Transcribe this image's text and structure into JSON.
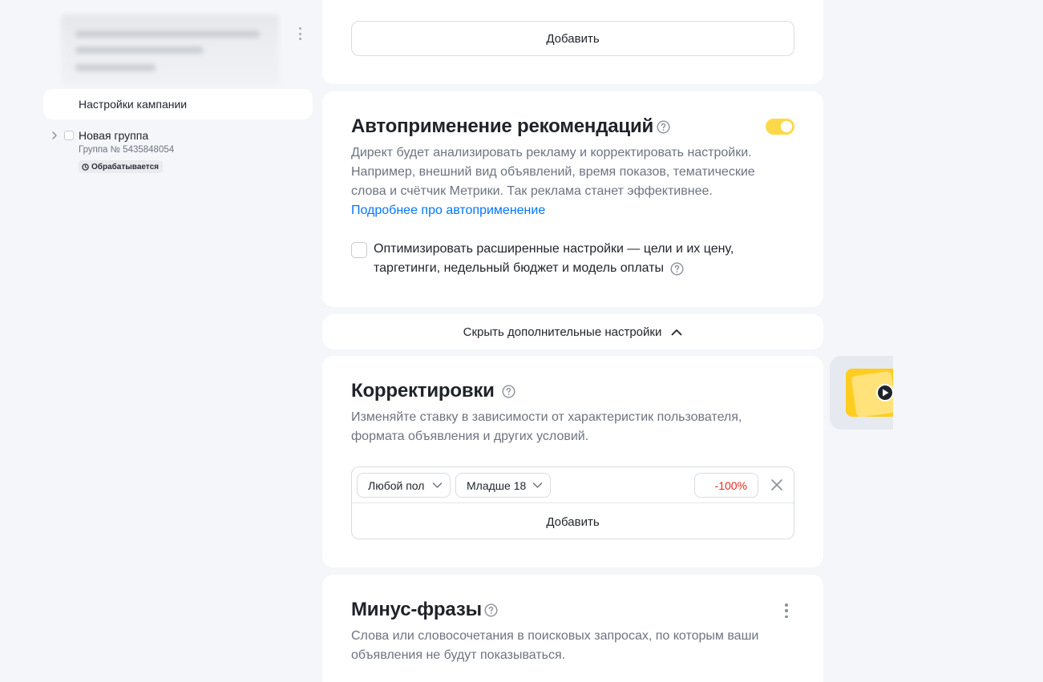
{
  "sidebar": {
    "nav_active": "Настройки кампании",
    "group": {
      "name": "Новая группа",
      "number": "Группа № 5435848054",
      "status": "Обрабатывается"
    }
  },
  "top_card": {
    "add_button": "Добавить"
  },
  "autoapply": {
    "title": "Автоприменение рекомендаций",
    "enabled": true,
    "description_lines": [
      "Директ будет анализировать рекламу и корректировать настройки.",
      "Например, внешний вид объявлений, время показов, тематические",
      "слова и счётчик Метрики. Так реклама станет эффективнее."
    ],
    "link": "Подробнее про автоприменение",
    "checkbox_checked": false,
    "checkbox_label_lines": [
      "Оптимизировать расширенные настройки — цели и их цену,",
      "таргетинги, недельный бюджет и модель оплаты"
    ]
  },
  "hide_settings": {
    "label": "Скрыть дополнительные настройки"
  },
  "adjustments": {
    "title": "Корректировки",
    "description_lines": [
      "Изменяйте ставку в зависимости от характеристик пользователя,",
      "формата объявления и других условий."
    ],
    "row": {
      "gender": "Любой пол",
      "age": "Младше 18",
      "percent": "-100%"
    },
    "add_button": "Добавить"
  },
  "minus_phrases": {
    "title": "Минус-фразы",
    "description_lines": [
      "Слова или словосочетания в поисковых запросах, по которым ваши",
      "объявления не будут показываться."
    ]
  },
  "colors": {
    "accent_link": "#0077ff",
    "toggle_on": "#fdd94a",
    "negative_value": "#e8261b",
    "page_bg": "#f4f6f9"
  },
  "icons": {
    "help": "question-circle-icon",
    "chevron_up": "chevron-up-icon",
    "chevron_down": "chevron-down-icon",
    "chevron_right": "chevron-right-icon",
    "close": "close-icon",
    "more": "more-vertical-icon",
    "play": "play-icon",
    "clock": "clock-icon"
  }
}
